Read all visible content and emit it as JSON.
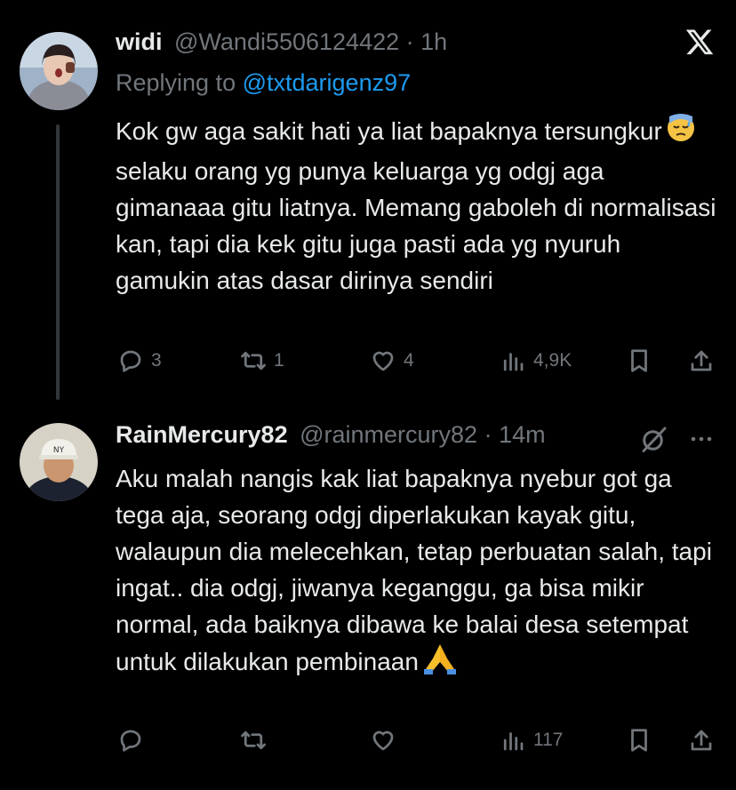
{
  "close_icon": "x-logo",
  "tweet1": {
    "display_name": "widi",
    "handle": "@Wandi5506124422",
    "separator": "·",
    "time": "1h",
    "replying_label": "Replying to",
    "replying_handle": "@txtdarigenz97",
    "text_before_emoji": "Kok gw aga sakit hati ya liat bapaknya tersungkur",
    "emoji": "downcast-face-with-sweat",
    "text_after_emoji": "selaku orang yg punya keluarga yg odgj aga gimanaaa gitu liatnya. Memang gaboleh di normalisasi kan, tapi dia kek gitu juga pasti ada yg nyuruh gamukin atas dasar dirinya sendiri",
    "replies": "3",
    "retweets": "1",
    "likes": "4",
    "views": "4,9K"
  },
  "tweet2": {
    "display_name": "RainMercury82",
    "handle": "@rainmercury82",
    "separator": "·",
    "time": "14m",
    "text": "Aku malah nangis kak liat bapaknya nyebur got  ga tega aja, seorang odgj diperlakukan kayak gitu, walaupun dia melecehkan, tetap perbuatan salah, tapi ingat.. dia odgj, jiwanya keganggu, ga bisa mikir normal, ada baiknya dibawa ke balai desa setempat untuk dilakukan pembinaan",
    "emoji": "folded-hands",
    "replies": "",
    "retweets": "",
    "likes": "",
    "views": "117"
  }
}
